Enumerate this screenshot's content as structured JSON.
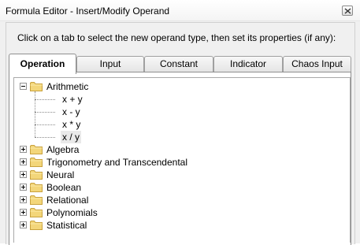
{
  "window": {
    "title": "Formula Editor - Insert/Modify Operand"
  },
  "instruction": "Click on a tab to select the new operand type, then set its properties (if any):",
  "tabs": [
    {
      "label": "Operation",
      "active": true
    },
    {
      "label": "Input",
      "active": false
    },
    {
      "label": "Constant",
      "active": false
    },
    {
      "label": "Indicator",
      "active": false
    },
    {
      "label": "Chaos Input",
      "active": false
    }
  ],
  "tree": {
    "expanded_category": "Arithmetic",
    "arithmetic_items": [
      "x + y",
      "x - y",
      "x * y",
      "x / y"
    ],
    "selected_item": "x / y",
    "categories": [
      "Arithmetic",
      "Algebra",
      "Trigonometry and Transcendental",
      "Neural",
      "Boolean",
      "Relational",
      "Polynomials",
      "Statistical"
    ]
  },
  "icons": {
    "folder": "folder-icon",
    "expand": "plus-box-icon",
    "collapse": "minus-box-icon",
    "close": "close-icon"
  },
  "colors": {
    "folder_fill": "#f3d67a",
    "folder_edge": "#c9a23e"
  }
}
